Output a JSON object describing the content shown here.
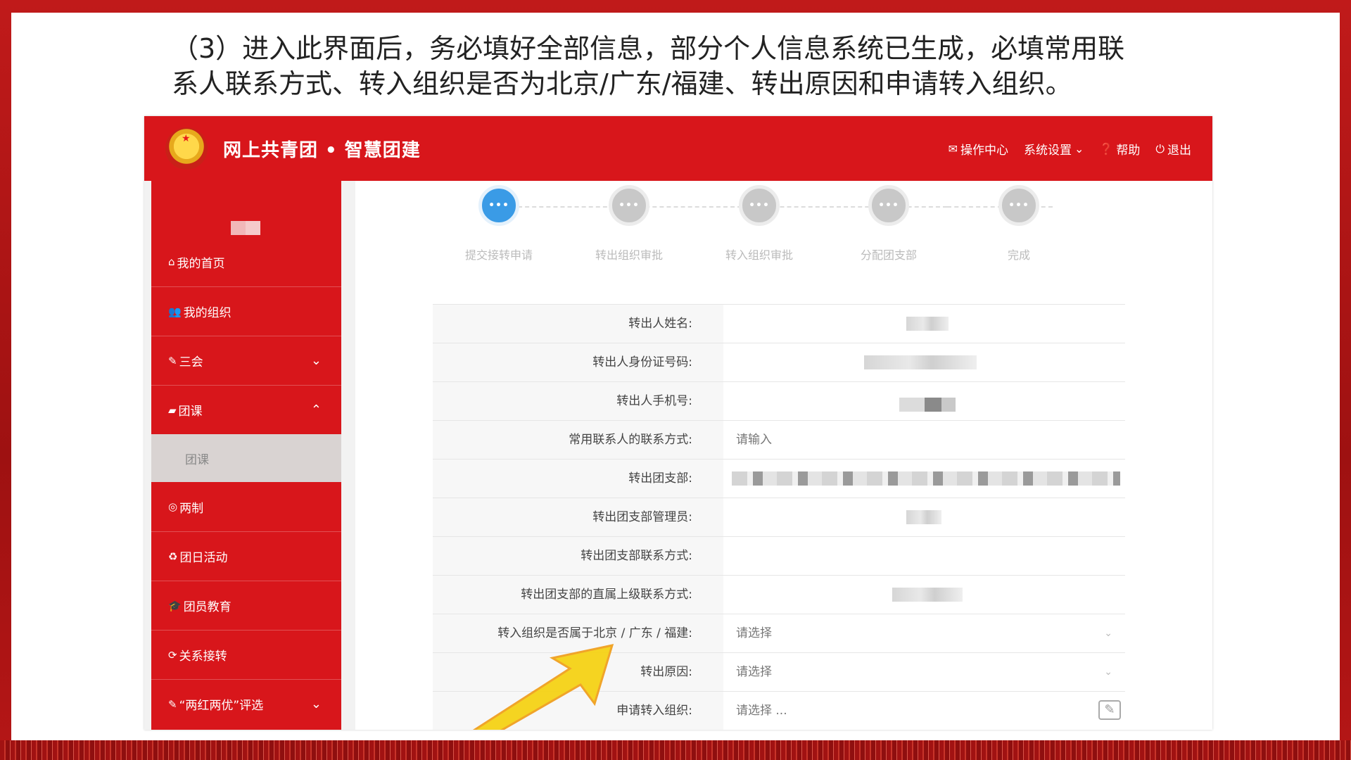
{
  "instruction": {
    "line1": "（3）进入此界面后，务必填好全部信息，部分个人信息系统已生成，必填常用联",
    "line2": "系人联系方式、转入组织是否为北京/广东/福建、转出原因和申请转入组织。"
  },
  "header": {
    "title": "网上共青团 • 智慧团建",
    "actions": {
      "ops_center": "操作中心",
      "system_settings": "系统设置",
      "help": "帮助",
      "logout": "退出"
    }
  },
  "sidebar": {
    "items": [
      {
        "label": "我的首页"
      },
      {
        "label": "我的组织"
      },
      {
        "label": "三会"
      },
      {
        "label": "团课"
      },
      {
        "label": "团课"
      },
      {
        "label": "两制"
      },
      {
        "label": "团日活动"
      },
      {
        "label": "团员教育"
      },
      {
        "label": "关系接转"
      },
      {
        "label": "“两红两优”评选"
      }
    ]
  },
  "steps": {
    "dot_text": "•••",
    "active_index": 0,
    "labels": [
      "提交接转申请",
      "转出组织审批",
      "转入组织审批",
      "分配团支部",
      "完成"
    ]
  },
  "form": {
    "rows": [
      {
        "label": "转出人姓名:",
        "required": false,
        "value": ""
      },
      {
        "label": "转出人身份证号码:",
        "required": false,
        "value": ""
      },
      {
        "label": "转出人手机号:",
        "required": false,
        "value": ""
      },
      {
        "label": "常用联系人的联系方式:",
        "required": true,
        "placeholder": "请输入"
      },
      {
        "label": "转出团支部:",
        "required": false,
        "value": ""
      },
      {
        "label": "转出团支部管理员:",
        "required": false,
        "value": ""
      },
      {
        "label": "转出团支部联系方式:",
        "required": false,
        "value": ""
      },
      {
        "label": "转出团支部的直属上级联系方式:",
        "required": false,
        "value": ""
      },
      {
        "label": "转入组织是否属于北京 / 广东 / 福建:",
        "required": true,
        "placeholder": "请选择"
      },
      {
        "label": "转出原因:",
        "required": true,
        "placeholder": "请选择"
      },
      {
        "label": "申请转入组织:",
        "required": true,
        "placeholder": "请选择 ..."
      }
    ],
    "required_mark": "*"
  },
  "colors": {
    "brand_red": "#d8161b",
    "active_step": "#3a9be6",
    "highlight": "#f5d316"
  }
}
